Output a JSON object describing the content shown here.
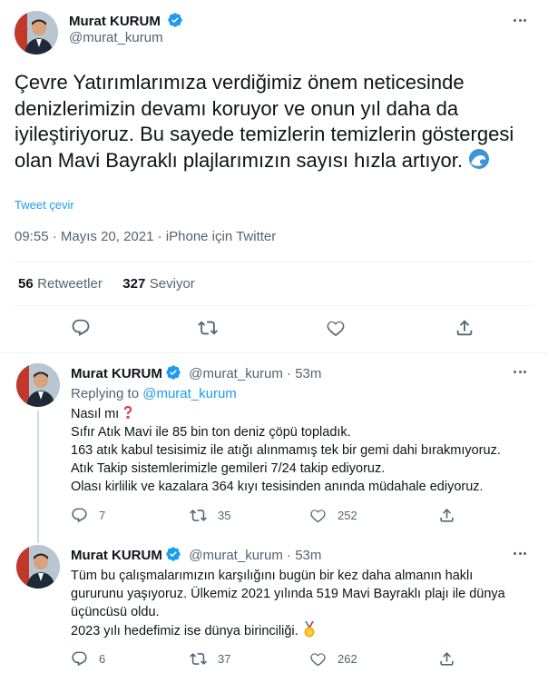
{
  "main": {
    "author_name": "Murat KURUM",
    "author_handle": "@murat_kurum",
    "text": "Çevre Yatırımlarımıza verdiğimiz önem neticesinde denizlerimizin devamı koruyor ve onun yıl daha da iyileştiriyoruz. Bu sayede temizlerin temizlerin göstergesi olan Mavi Bayraklı plajlarımızın sayısı hızla artıyor.",
    "emoji": "wave-emoji",
    "translate_label": "Tweet çevir",
    "time": "09:55",
    "date": "Mayıs 20, 2021",
    "source": "iPhone için Twitter",
    "retweets_count": "56",
    "retweets_label": "Retweetler",
    "likes_count": "327",
    "likes_label": "Seviyor"
  },
  "replies": [
    {
      "author_name": "Murat KURUM",
      "author_handle": "@murat_kurum",
      "age": "53m",
      "replying_prefix": "Replying to",
      "replying_handle": "@murat_kurum",
      "lines": [
        "Nasıl mı",
        "Sıfır Atık Mavi ile 85 bin ton deniz çöpü topladık.",
        "163 atık kabul tesisimiz ile atığı alınmamış tek bir gemi dahi bırakmıyoruz.",
        "Atık Takip sistemlerimizle gemileri 7/24 takip ediyoruz.",
        "Olası kirlilik ve kazalara 364 kıyı tesisinden anında müdahale ediyoruz."
      ],
      "replies_count": "7",
      "retweets_count": "35",
      "likes_count": "252"
    },
    {
      "author_name": "Murat KURUM",
      "author_handle": "@murat_kurum",
      "age": "53m",
      "lines": [
        "Tüm bu çalışmalarımızın karşılığını bugün bir kez daha almanın haklı",
        "gururunu yaşıyoruz. Ülkemiz 2021 yılında 519 Mavi Bayraklı plajı ile dünya",
        "üçüncüsü oldu.",
        "2023 yılı hedefimiz ise dünya birinciliği."
      ],
      "replies_count": "6",
      "retweets_count": "37",
      "likes_count": "262"
    }
  ],
  "colors": {
    "accent": "#1d9bf0",
    "secondary_text": "#536471",
    "separator": "#eff3f4"
  },
  "icons": [
    "verified-badge-icon",
    "more-icon",
    "reply-icon",
    "retweet-icon",
    "like-icon",
    "share-icon",
    "red-question-emoji",
    "medal-emoji"
  ]
}
